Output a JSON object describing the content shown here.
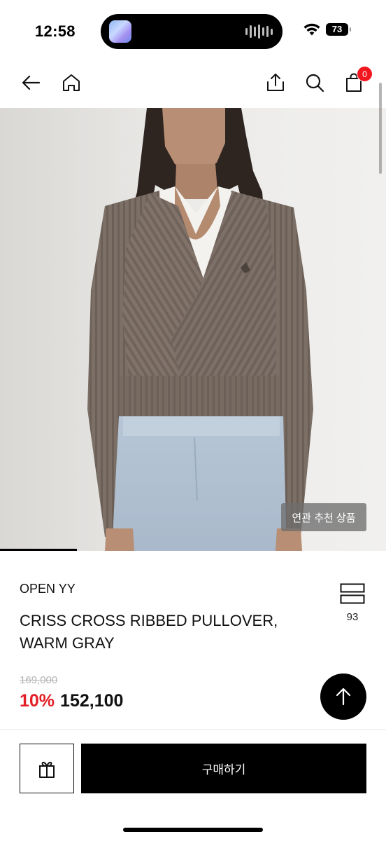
{
  "status_bar": {
    "time": "12:58",
    "battery": "73"
  },
  "nav": {
    "icons": [
      "back-arrow-icon",
      "home-icon",
      "share-icon",
      "search-icon",
      "cart-icon"
    ],
    "cart_count": "0"
  },
  "product": {
    "related_label": "연관 추천 상품",
    "brand": "OPEN YY",
    "title": "CRISS CROSS RIBBED PULLOVER, WARM GRAY",
    "like_count": "93",
    "original_price": "169,000",
    "discount_rate": "10%",
    "sale_price": "152,100",
    "image_progress": 0.2
  },
  "bottom_bar": {
    "buy_label": "구매하기"
  },
  "colors": {
    "accent": "#e31e26",
    "badge": "#f2171f",
    "primary": "#000000"
  }
}
